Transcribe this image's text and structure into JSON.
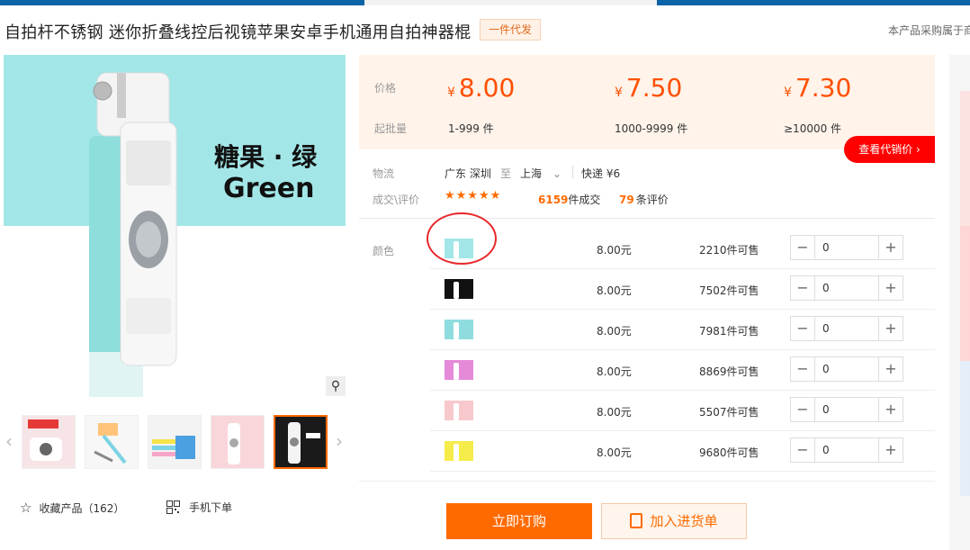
{
  "header": {
    "title": "自拍杆不锈钢 迷你折叠线控后视镜苹果安卓手机通用自拍神器棍",
    "badge": "一件代发",
    "notice": "本产品采购属于商"
  },
  "gallery": {
    "main_text_cn": "糖果 · 绿",
    "main_text_en": "Green",
    "zoom_icon": "magnifier-icon",
    "prev_arrow": "‹",
    "next_arrow": "›"
  },
  "actions": {
    "favorite_label": "收藏产品",
    "favorite_count": "（162）",
    "mobile_order_label": "手机下单"
  },
  "pricing": {
    "price_label": "价格",
    "qty_label": "起批量",
    "currency": "¥",
    "tiers": [
      {
        "price": "8.00",
        "qty": "1-999 件"
      },
      {
        "price": "7.50",
        "qty": "1000-9999 件"
      },
      {
        "price": "7.30",
        "qty": "≥10000 件"
      }
    ],
    "agent_price_button": "查看代销价 ›"
  },
  "logistics": {
    "label": "物流",
    "from": "广东 深圳",
    "to_word": "至",
    "to": "上海",
    "express": "快递 ¥6"
  },
  "reviews": {
    "label": "成交\\评价",
    "stars": "★★★★★",
    "sold_count": "6159",
    "sold_suffix": "件成交",
    "review_count": "79",
    "review_suffix": "条评价"
  },
  "variants": {
    "label": "颜色",
    "rows": [
      {
        "price": "8.00元",
        "stock": "2210件可售",
        "qty": "0",
        "color": "#a3e6e7"
      },
      {
        "price": "8.00元",
        "stock": "7502件可售",
        "qty": "0",
        "color": "#111111"
      },
      {
        "price": "8.00元",
        "stock": "7981件可售",
        "qty": "0",
        "color": "#8fdcdf"
      },
      {
        "price": "8.00元",
        "stock": "8869件可售",
        "qty": "0",
        "color": "#e58ad9"
      },
      {
        "price": "8.00元",
        "stock": "5507件可售",
        "qty": "0",
        "color": "#f7c9cd"
      },
      {
        "price": "8.00元",
        "stock": "9680件可售",
        "qty": "0",
        "color": "#f5ec4a"
      }
    ]
  },
  "buttons": {
    "order_now": "立即订购",
    "add_to_list": "加入进货单"
  }
}
